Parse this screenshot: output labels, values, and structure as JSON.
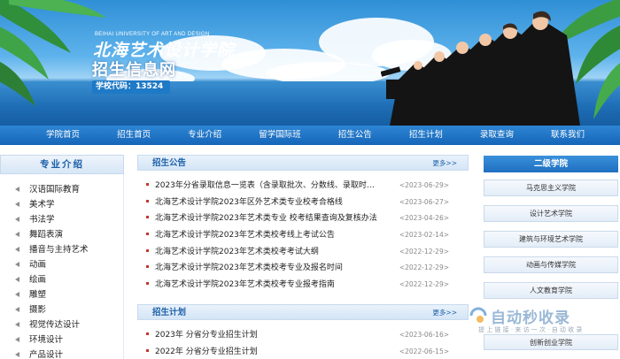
{
  "banner": {
    "logo_en": "BEIHAI UNIVERSITY OF ART AND DESIGN",
    "logo_cn": "北海艺术设计学院",
    "recruit_title": "招生信息网",
    "school_code": "学校代码：13524"
  },
  "nav": [
    "学院首页",
    "招生首页",
    "专业介绍",
    "留学国际班",
    "招生公告",
    "招生计划",
    "录取查询",
    "联系我们"
  ],
  "majors": {
    "title": "专业介绍",
    "items": [
      "汉语国际教育",
      "美术学",
      "书法学",
      "舞蹈表演",
      "播音与主持艺术",
      "动画",
      "绘画",
      "雕塑",
      "摄影",
      "视觉传达设计",
      "环境设计",
      "产品设计"
    ]
  },
  "notices": {
    "title": "招生公告",
    "more": "更多>>",
    "items": [
      {
        "title": "2023年分省录取信息一览表（含录取批次、分数线、录取时…",
        "date": "<2023-06-29>"
      },
      {
        "title": "北海艺术设计学院2023年区外艺术类专业校考合格线",
        "date": "<2023-06-27>"
      },
      {
        "title": "北海艺术设计学院2023年艺术类专业 校考结果查询及复核办法",
        "date": "<2023-04-26>"
      },
      {
        "title": "北海艺术设计学院2023年艺术类校考线上考试公告",
        "date": "<2023-02-14>"
      },
      {
        "title": "北海艺术设计学院2023年艺术类校考考试大纲",
        "date": "<2022-12-29>"
      },
      {
        "title": "北海艺术设计学院2023年艺术类校考专业及报名时间",
        "date": "<2022-12-29>"
      },
      {
        "title": "北海艺术设计学院2023年艺术类校考专业报考指南",
        "date": "<2022-12-29>"
      }
    ]
  },
  "plans": {
    "title": "招生计划",
    "more": "更多>>",
    "items": [
      {
        "title": "2023年 分省分专业招生计划",
        "date": "<2023-06-16>"
      },
      {
        "title": "2022年 分省分专业招生计划",
        "date": "<2022-06-15>"
      }
    ]
  },
  "colleges": {
    "title": "二级学院",
    "items": [
      "马克思主义学院",
      "设计艺术学院",
      "建筑与环境艺术学院",
      "动画与传媒学院",
      "人文教育学院",
      "创新创业学院"
    ]
  },
  "watermark": {
    "main": "自动秒收录",
    "sub": "提 上 链 接 · 来 访 一 次 · 自 动 收 录"
  },
  "colors": {
    "nav_bg": "#1f6fc0",
    "accent": "#1b5fa8",
    "bullet": "#c0392b"
  }
}
